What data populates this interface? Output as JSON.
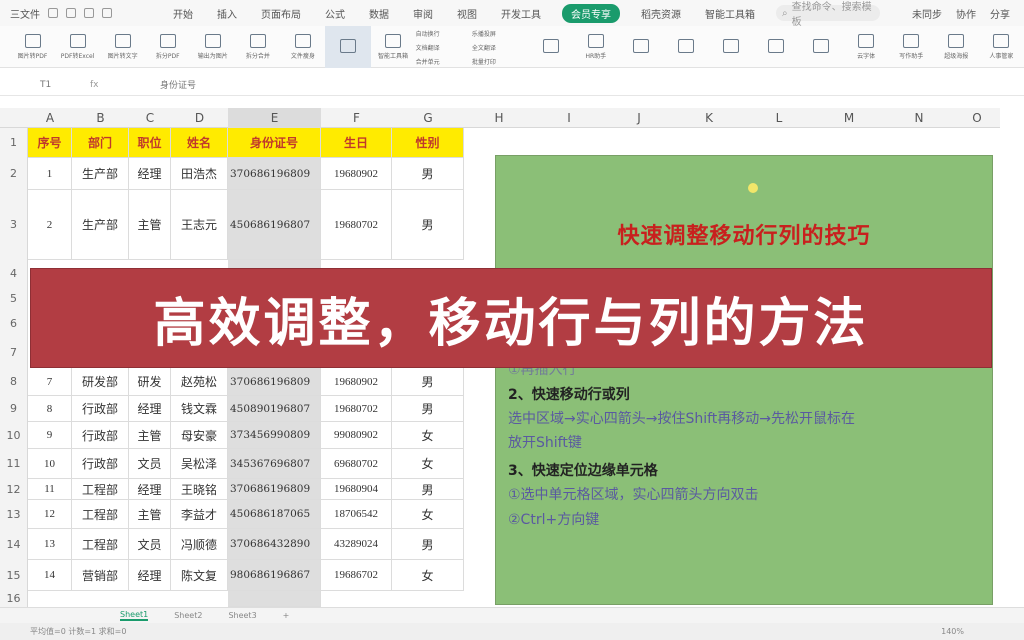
{
  "menubar": {
    "file_label": "三文件",
    "tabs": [
      "开始",
      "插入",
      "页面布局",
      "公式",
      "数据",
      "审阅",
      "视图",
      "开发工具",
      "会员专享",
      "稻壳资源",
      "智能工具箱"
    ],
    "active_tab_index": 8,
    "search_placeholder": "查找命令、搜索模板",
    "right_items": [
      "未同步",
      "协作",
      "分享"
    ]
  },
  "ribbon": {
    "buttons": [
      "图片转PDF",
      "PDF转Excel",
      "图片转文字",
      "拆分PDF",
      "输出为图片",
      "拆分合并",
      "文件瘦身",
      "",
      "智能工具箱",
      "",
      "HR助手",
      "",
      "",
      "",
      "",
      "",
      "云字体",
      "写作助手",
      "超级海报",
      "人事管家"
    ],
    "small_items": [
      "自动换行",
      "文档翻译",
      "合并单元",
      "乐播投屏",
      "全文翻译",
      "批量打印"
    ],
    "selected_index": 7
  },
  "formula_bar": {
    "cell_ref": "T1",
    "fx": "fx",
    "value": "身份证号"
  },
  "columns": [
    "A",
    "B",
    "C",
    "D",
    "E",
    "F",
    "G",
    "H",
    "I",
    "J",
    "K",
    "L",
    "M",
    "N",
    "O"
  ],
  "row_numbers": [
    "1",
    "2",
    "3",
    "4",
    "5",
    "6",
    "7",
    "8",
    "9",
    "10",
    "11",
    "12",
    "13",
    "14",
    "15",
    "16"
  ],
  "table": {
    "headers": [
      "序号",
      "部门",
      "职位",
      "姓名",
      "身份证号",
      "生日",
      "性别"
    ],
    "rows": [
      [
        "1",
        "生产部",
        "经理",
        "田浩杰",
        "370686196809",
        "19680902",
        "男"
      ],
      [
        "2",
        "生产部",
        "主管",
        "王志元",
        "450686196807",
        "19680702",
        "男"
      ],
      [
        "7",
        "研发部",
        "研发",
        "赵苑松",
        "370686196809",
        "19680902",
        "男"
      ],
      [
        "8",
        "行政部",
        "经理",
        "钱文霖",
        "450890196807",
        "19680702",
        "男"
      ],
      [
        "9",
        "行政部",
        "主管",
        "母安豪",
        "373456990809",
        "99080902",
        "女"
      ],
      [
        "10",
        "行政部",
        "文员",
        "吴松泽",
        "345367696807",
        "69680702",
        "女"
      ],
      [
        "11",
        "工程部",
        "经理",
        "王晓铭",
        "370686196809",
        "19680904",
        "男"
      ],
      [
        "12",
        "工程部",
        "主管",
        "李益才",
        "450686187065",
        "18706542",
        "女"
      ],
      [
        "13",
        "工程部",
        "文员",
        "冯顺德",
        "370686432890",
        "43289024",
        "男"
      ],
      [
        "14",
        "营销部",
        "经理",
        "陈文复",
        "980686196867",
        "19686702",
        "女"
      ]
    ]
  },
  "panel": {
    "title": "快速调整移动行列的技巧",
    "line_partial": "①再插入行",
    "section2_title": "2、快速移动行或列",
    "section2_text_1": "选中区域→实心四箭头→按住Shift再移动→先松开鼠标在",
    "section2_text_2": "放开Shift键",
    "section3_title": "3、快速定位边缘单元格",
    "section3_text_1": "①选中单元格区域，实心四箭头方向双击",
    "section3_text_2": "②Ctrl+方向键"
  },
  "banner": {
    "text": "高效调整，移动行与列的方法"
  },
  "sheet_tabs": [
    "Sheet1",
    "Sheet2",
    "Sheet3",
    "+"
  ],
  "status": {
    "left": "平均值=0  计数=1  求和=0",
    "zoom": "140%"
  },
  "colors": {
    "header_yellow": "#ffeb00",
    "header_text": "#c0392b",
    "banner_bg": "#b23d43",
    "panel_bg": "#8bbf77",
    "accent": "#1a9b6c"
  }
}
